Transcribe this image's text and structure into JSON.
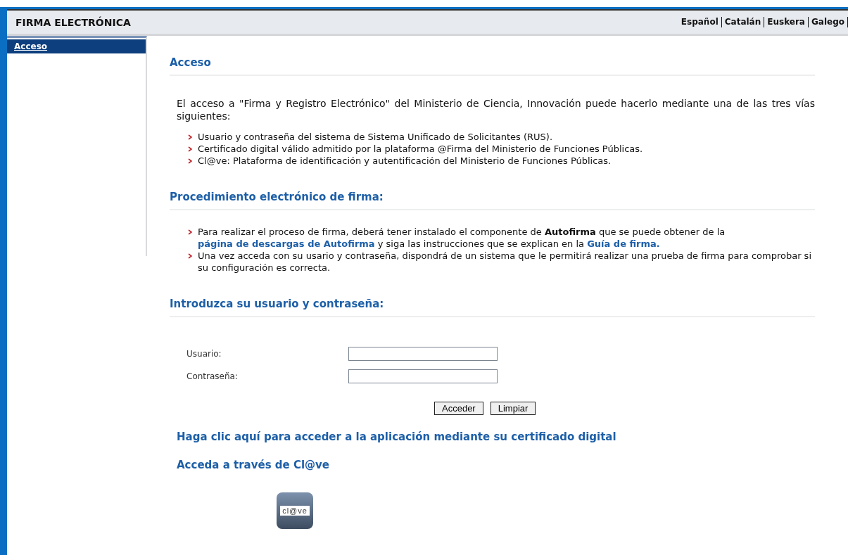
{
  "header": {
    "title": "FIRMA ELECTRÓNICA",
    "languages": [
      "Español",
      "Catalán",
      "Euskera",
      "Galego"
    ]
  },
  "sidebar": {
    "items": [
      {
        "label": "Acceso",
        "selected": true
      }
    ]
  },
  "sections": [
    {
      "heading": "Acceso",
      "paragraph": "El acceso a \"Firma y Registro Electrónico\" del Ministerio de Ciencia, Innovación puede hacerlo mediante una de las tres vías siguientes:",
      "bullets": [
        [
          {
            "kind": "text",
            "text": "Usuario y contraseña del sistema de Sistema Unificado de Solicitantes (RUS)."
          }
        ],
        [
          {
            "kind": "text",
            "text": "Certificado digital válido admitido por la plataforma @Firma del Ministerio de Funciones Públicas."
          }
        ],
        [
          {
            "kind": "text",
            "text": "Cl@ve: Plataforma de identificación y autentificación del Ministerio de Funciones Públicas."
          }
        ]
      ]
    },
    {
      "heading": "Procedimiento electrónico de firma:",
      "bullets": [
        [
          {
            "kind": "text",
            "text": "Para realizar el proceso de firma, deberá tener instalado el componente de **Autofirma** que se puede obtener de la"
          },
          {
            "kind": "link",
            "text": "página de descargas de Autofirma"
          },
          {
            "kind": "text",
            "text": "y siga las instrucciones que se explican en la"
          },
          {
            "kind": "link",
            "text": "Guía de firma."
          }
        ],
        [
          {
            "kind": "text",
            "text": "Una vez acceda con su usario y contraseña, dispondrá de un sistema que le permitirá realizar una prueba de firma para comprobar si su configuración es correcta."
          }
        ]
      ]
    },
    {
      "heading": "Introduzca su usuario y contraseña:"
    }
  ],
  "form": {
    "fields": [
      {
        "label": "Usuario:"
      },
      {
        "label": "Contraseña:"
      }
    ],
    "buttons": [
      "Acceder",
      "Limpiar"
    ]
  },
  "links": [
    "Haga clic aquí para acceder a la aplicación mediante su certificado digital",
    "Acceda a través de Cl@ve"
  ],
  "clave_logo": {
    "text": "cl@ve"
  }
}
